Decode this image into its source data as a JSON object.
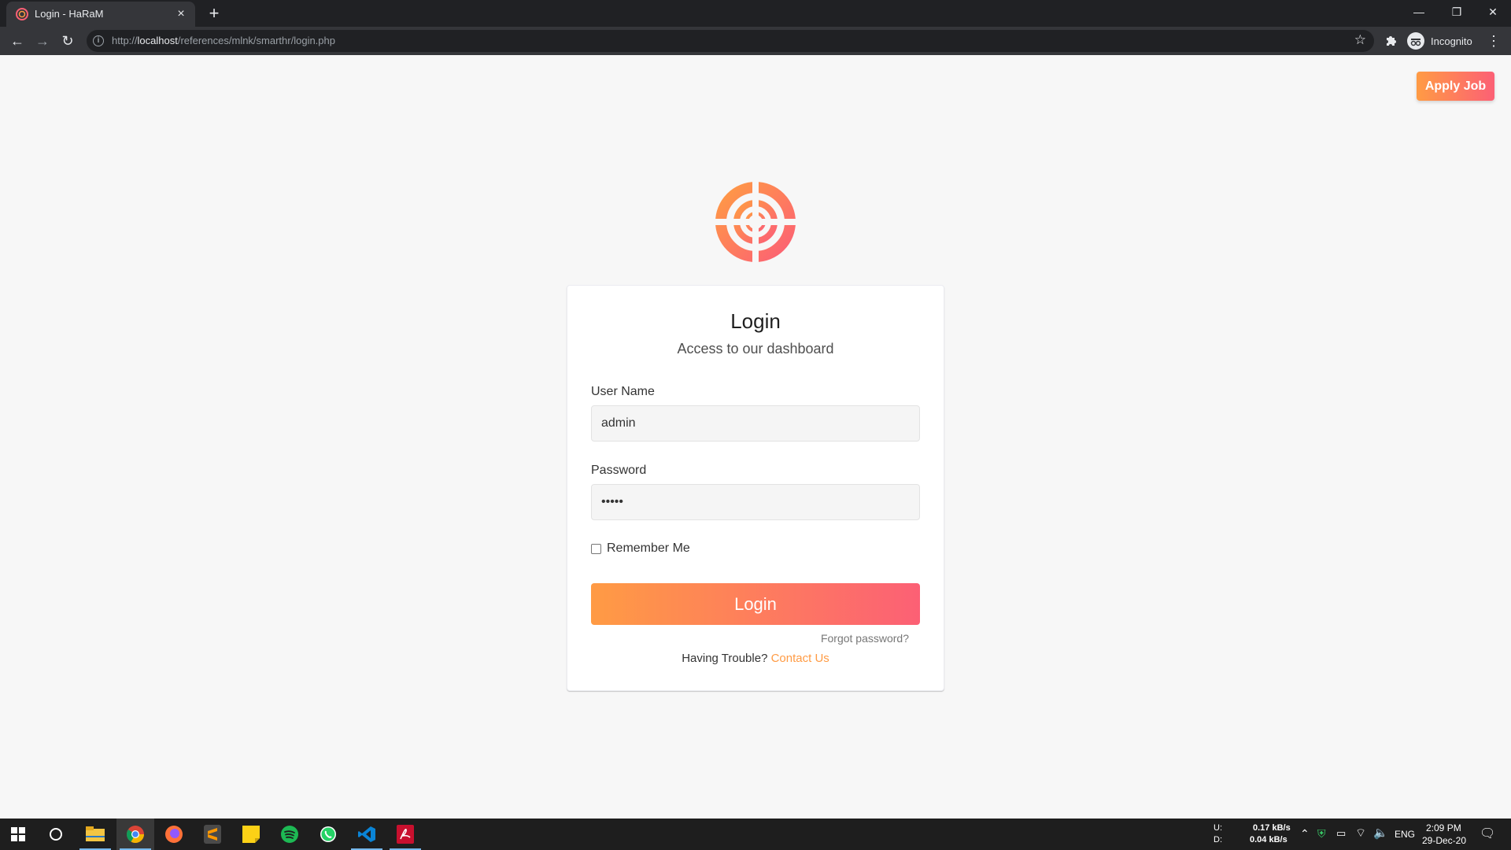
{
  "browser": {
    "tab_title": "Login - HaRaM",
    "tab_close": "×",
    "new_tab": "+",
    "url_prefix": "http://",
    "url_host": "localhost",
    "url_path": "/references/mlnk/smarthr/login.php",
    "profile_label": "Incognito",
    "window_controls": {
      "minimize": "—",
      "restore": "❐",
      "close": "✕"
    }
  },
  "page": {
    "apply_job_label": "Apply Job",
    "title": "Login",
    "subtitle": "Access to our dashboard",
    "username_label": "User Name",
    "username_value": "admin",
    "password_label": "Password",
    "password_value": "•••••",
    "remember_label": "Remember Me",
    "remember_checked": false,
    "login_button": "Login",
    "forgot_link": "Forgot password?",
    "trouble_text": "Having Trouble?",
    "contact_link": "Contact Us"
  },
  "colors": {
    "accent_start": "#ff9b44",
    "accent_end": "#fc6075",
    "page_bg": "#f7f7f7"
  },
  "taskbar": {
    "apps": [
      "windows-start-icon",
      "cortana-icon",
      "file-explorer-icon",
      "chrome-icon",
      "firefox-icon",
      "sublime-text-icon",
      "sticky-notes-icon",
      "spotify-icon",
      "whatsapp-icon",
      "vscode-icon",
      "acrobat-icon"
    ],
    "net_u_label": "U:",
    "net_d_label": "D:",
    "net_up": "0.17 kB/s",
    "net_down": "0.04 kB/s",
    "language": "ENG",
    "time": "2:09 PM",
    "date": "29-Dec-20"
  }
}
